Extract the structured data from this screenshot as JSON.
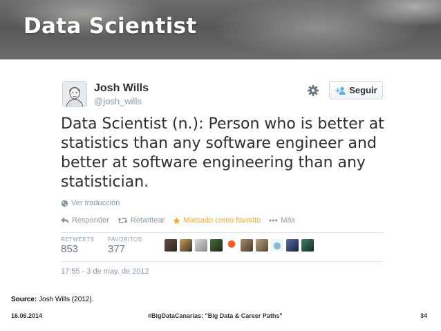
{
  "slide": {
    "title": "Data Scientist",
    "source_label": "Source:",
    "source_text": " Josh Wills (2012).",
    "footer_date": "16.06.2014",
    "footer_event": "#BigDataCanarias: \"Big Data & Career Paths\"",
    "page_number": "34"
  },
  "tweet": {
    "author_name": "Josh Wills",
    "author_handle": "@josh_wills",
    "follow_label": "Seguir",
    "text": "Data Scientist (n.): Person who is better at statistics than any software engineer and better at software engineering than any statistician.",
    "translate_label": "Ver traducción",
    "actions": {
      "reply": "Responder",
      "retweet": "Retwittear",
      "favorite": "Marcado como favorito",
      "more": "Más"
    },
    "stats": {
      "retweets_label": "RETWEETS",
      "retweets_value": "853",
      "favorites_label": "FAVORITOS",
      "favorites_value": "377"
    },
    "timestamp": "17:55 - 3 de may. de 2012",
    "colors": {
      "favorite_accent": "#f5a623",
      "follow_icon_blue": "#55acee"
    },
    "icons": [
      "gear-icon",
      "add-user-icon",
      "globe-icon",
      "reply-icon",
      "retweet-icon",
      "star-icon",
      "more-dots-icon"
    ]
  }
}
